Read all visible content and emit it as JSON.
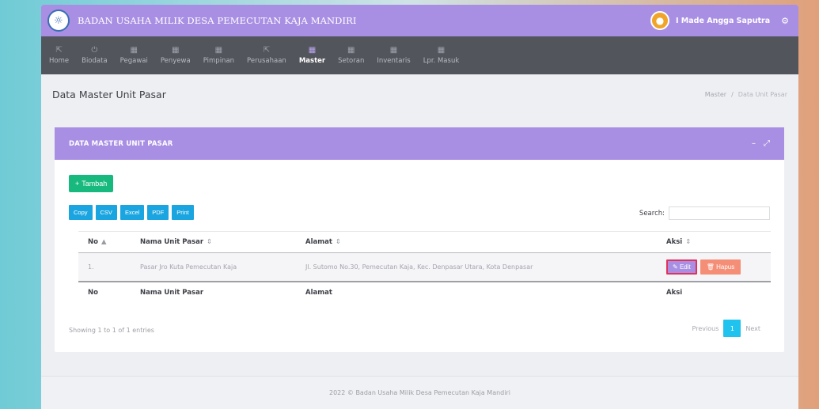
{
  "app": {
    "title": "BADAN USAHA MILIK DESA PEMECUTAN KAJA MANDIRI",
    "user_name": "I Made Angga Saputra"
  },
  "nav": [
    {
      "label": "Home",
      "icon": "pointer-icon",
      "glyph": "⇱",
      "active": false
    },
    {
      "label": "Biodata",
      "icon": "power-icon",
      "glyph": "⏻",
      "active": false
    },
    {
      "label": "Pegawai",
      "icon": "grid-icon",
      "glyph": "▦",
      "active": false
    },
    {
      "label": "Penyewa",
      "icon": "grid-icon",
      "glyph": "▦",
      "active": false
    },
    {
      "label": "Pimpinan",
      "icon": "grid-icon",
      "glyph": "▦",
      "active": false
    },
    {
      "label": "Perusahaan",
      "icon": "pointer-icon",
      "glyph": "⇱",
      "active": false
    },
    {
      "label": "Master",
      "icon": "grid-icon",
      "glyph": "▦",
      "active": true
    },
    {
      "label": "Setoran",
      "icon": "grid-icon",
      "glyph": "▦",
      "active": false
    },
    {
      "label": "Inventaris",
      "icon": "grid-icon",
      "glyph": "▦",
      "active": false
    },
    {
      "label": "Lpr. Masuk",
      "icon": "grid-icon",
      "glyph": "▦",
      "active": false
    }
  ],
  "header": {
    "page_title": "Data Master Unit Pasar",
    "breadcrumb_root": "Master",
    "breadcrumb_sep": "/",
    "breadcrumb_current": "Data Unit Pasar"
  },
  "card": {
    "title": "DATA MASTER UNIT PASAR",
    "tambah_label": "Tambah",
    "export_buttons": [
      "Copy",
      "CSV",
      "Excel",
      "PDF",
      "Print"
    ],
    "search_label": "Search:",
    "search_value": ""
  },
  "table": {
    "columns": [
      "No",
      "Nama Unit Pasar",
      "Alamat",
      "Aksi"
    ],
    "rows": [
      {
        "no": "1.",
        "nama": "Pasar Jro Kuta Pemecutan Kaja",
        "alamat": "Jl. Sutomo No.30, Pemecutan Kaja, Kec. Denpasar Utara, Kota Denpasar",
        "edit_label": "Edit",
        "hapus_label": "Hapus"
      }
    ],
    "info": "Showing 1 to 1 of 1 entries"
  },
  "pagination": {
    "previous": "Previous",
    "current": "1",
    "next": "Next"
  },
  "footer": {
    "text": "2022 © Badan Usaha Milik Desa Pemecutan Kaja Mandiri"
  },
  "colors": {
    "accent_purple": "#a98fe3",
    "nav_dark": "#53555c",
    "success_green": "#18b97e",
    "export_blue": "#1aa5e0",
    "danger_salmon": "#f58e76",
    "page_active": "#1fc3ee"
  }
}
